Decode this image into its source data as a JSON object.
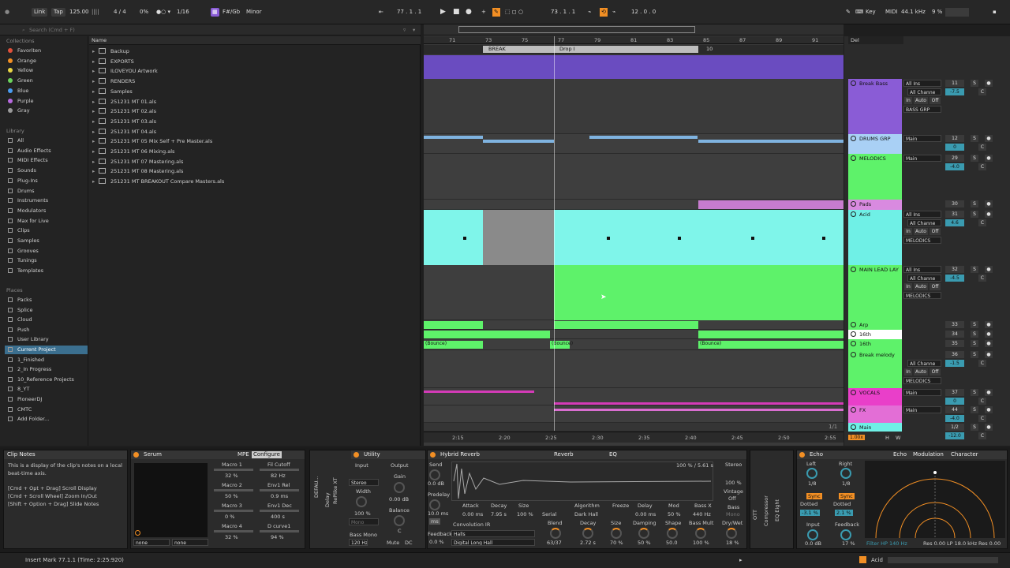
{
  "transport": {
    "link": "Link",
    "tap": "Tap",
    "tempo": "125.00",
    "meter": "4 / 4",
    "cpu_pct": "0%",
    "quant": "1/16",
    "key": "F#/Gb",
    "scale": "Minor",
    "position": "77 .  1 .  1",
    "loop_start": "73 .  1 .  1",
    "loop_len": "12 .  0 .  0",
    "key_label": "Key",
    "midi_label": "MIDI",
    "sample_rate": "44.1 kHz",
    "cpu": "9 %"
  },
  "browser": {
    "search_placeholder": "Search (Cmd + F)",
    "name_header": "Name",
    "collections_title": "Collections",
    "collections": [
      {
        "label": "Favoriten",
        "color": "#e0513b"
      },
      {
        "label": "Orange",
        "color": "#f28f24"
      },
      {
        "label": "Yellow",
        "color": "#e9d545"
      },
      {
        "label": "Green",
        "color": "#6bd35c"
      },
      {
        "label": "Blue",
        "color": "#4a9cf0"
      },
      {
        "label": "Purple",
        "color": "#b86ae0"
      },
      {
        "label": "Gray",
        "color": "#9a9a9a"
      }
    ],
    "library_title": "Library",
    "library": [
      "All",
      "Audio Effects",
      "MIDI Effects",
      "Sounds",
      "Plug-Ins",
      "Drums",
      "Instruments",
      "Modulators",
      "Max for Live",
      "Clips",
      "Samples",
      "Grooves",
      "Tunings",
      "Templates"
    ],
    "places_title": "Places",
    "places": [
      "Packs",
      "Splice",
      "Cloud",
      "Push",
      "User Library",
      "Current Project",
      "1_Finished",
      "2_In Progress",
      "10_Reference Projects",
      "8_YT",
      "PioneerDJ",
      "CMTC",
      "Add Folder..."
    ],
    "files": [
      "Backup",
      "EXPORTS",
      "ILOVEYOU Artwork",
      "RENDERS",
      "Samples",
      "251231 MT 01.als",
      "251231 MT 02.als",
      "251231 MT 03.als",
      "251231 MT 04.als",
      "251231 MT 05 Mix Self + Pre Master.als",
      "251231 MT 06 Mixing.als",
      "251231 MT 07 Mastering.als",
      "251231 MT 08 Mastering.als",
      "251231 MT BREAKOUT Compare Masters.als"
    ]
  },
  "arrangement": {
    "bars": [
      "71",
      "73",
      "75",
      "77",
      "79",
      "81",
      "83",
      "85",
      "87",
      "89",
      "91",
      "93"
    ],
    "locators": [
      "BREAK",
      "Drop I",
      "10"
    ],
    "times": [
      "2:15",
      "2:20",
      "2:25",
      "2:30",
      "2:35",
      "2:40",
      "2:45",
      "2:50",
      "2:55"
    ],
    "bounce": "(Bounce)",
    "zoom": "1/1"
  },
  "tracks": [
    {
      "name": "Break Bass",
      "color": "#8a5cd6",
      "num": "11",
      "vol": "-7.5",
      "io": "All Ins",
      "ch": "All Channe",
      "out": "BASS GRP"
    },
    {
      "name": "DRUMS GRP",
      "color": "#a9d0f5",
      "num": "12",
      "vol": "0",
      "io": "Main"
    },
    {
      "name": "MELODICS",
      "color": "#5ef26a",
      "num": "29",
      "vol": "-4.0",
      "io": "Main"
    },
    {
      "name": "Pads",
      "color": "#d98ae0",
      "num": "30"
    },
    {
      "name": "Acid",
      "color": "#6ff0e6",
      "num": "31",
      "vol": "4.6",
      "io": "All Ins",
      "ch": "All Channe",
      "out": "MELODICS"
    },
    {
      "name": "MAIN LEAD LAY",
      "color": "#5ef26a",
      "num": "32",
      "vol": "-4.5",
      "io": "All Ins",
      "ch": "All Channe",
      "out": "MELODICS"
    },
    {
      "name": "Arp",
      "color": "#5ef26a",
      "num": "33"
    },
    {
      "name": "16th",
      "color": "#ffffff",
      "num": "34"
    },
    {
      "name": "16th",
      "color": "#5ef26a",
      "num": "35"
    },
    {
      "name": "Break melody",
      "color": "#5ef26a",
      "num": "36",
      "vol": "-1.5",
      "ch": "All Channe",
      "out": "MELODICS"
    },
    {
      "name": "VOCALS",
      "color": "#e93fc9",
      "num": "37",
      "vol": "0",
      "io": "Main"
    },
    {
      "name": "FX",
      "color": "#e36ed6",
      "num": "44",
      "vol": "-4.0",
      "io": "Main"
    },
    {
      "name": "Main",
      "color": "#6ff0e6",
      "num": "1/2",
      "vol": "-12.0"
    }
  ],
  "mixer": {
    "auto": "Auto",
    "in": "In",
    "off": "Off",
    "s": "S",
    "c": "C",
    "dei": "Del",
    "main_zoom": "1.00x",
    "h": "H",
    "w": "W"
  },
  "clip_notes": {
    "title": "Clip Notes",
    "text1": "This is a display of the clip's notes on a local beat-time axis.",
    "text2": "[Cmd + Opt + Drag] Scroll Display",
    "text3": "[Cmd + Scroll Wheel] Zoom In/Out",
    "text4": "[Shift + Option + Drag] Slide Notes"
  },
  "serum": {
    "title": "Serum",
    "mpe": "MPE",
    "configure": "Configure",
    "macros": [
      {
        "name": "Macro 1",
        "val": "32 %"
      },
      {
        "name": "Fil Cutoff",
        "val": "82 Hz"
      },
      {
        "name": "Macro 2",
        "val": "50 %"
      },
      {
        "name": "Env1 Rel",
        "val": "0.9 ms"
      },
      {
        "name": "Macro 3",
        "val": "0 %"
      },
      {
        "name": "Env1 Dec",
        "val": "400 s"
      },
      {
        "name": "Macro 4",
        "val": "32 %"
      },
      {
        "name": "D curve1",
        "val": "94 %"
      }
    ],
    "none1": "none",
    "none2": "none"
  },
  "utility": {
    "title": "Utility",
    "input": "Input",
    "output": "Output",
    "gain": "Gain",
    "gain_val": "0.00 dB",
    "width": "Width",
    "width_val": "100 %",
    "stereo": "Stereo",
    "mono": "Mono",
    "balance": "Balance",
    "bal_val": "C",
    "bass_mono": "Bass Mono",
    "freq": "120 Hz",
    "mute": "Mute",
    "dc": "DC",
    "vertical": [
      "DEFAU...",
      "RePlike XT",
      "Delay"
    ]
  },
  "reverb": {
    "title": "Hybrid Reverb",
    "tab1": "Reverb",
    "tab2": "EQ",
    "send": "Send",
    "send_val": "0.0 dB",
    "predelay": "Predelay",
    "predelay_val": "10.0 ms",
    "ms": "ms",
    "feedback": "Feedback",
    "feedback_val": "0.0 %",
    "readout": "100 % / 5.61 s",
    "attack": "Attack",
    "decay": "Decay",
    "size": "Size",
    "algorithm": "Algorithm",
    "freeze": "Freeze",
    "delay": "Delay",
    "mod": "Mod",
    "bassx": "Bass X",
    "attack_val": "0.00 ms",
    "decay_val": "7.95 s",
    "size_val": "100 %",
    "serial": "Serial",
    "dark_hall": "Dark Hall",
    "delay_val": "0.00 ms",
    "mod_val": "50 %",
    "bassx_val": "440 Hz",
    "conv": "Convolution IR",
    "halls": "Halls",
    "digital": "Digital Long Hall",
    "blend": "Blend",
    "blend_val": "63/37",
    "decay2": "Decay",
    "decay2_val": "2.72 s",
    "size2": "Size",
    "size2_val": "70 %",
    "damping": "Damping",
    "damp_val": "50 %",
    "shape": "Shape",
    "shape_val": "50.0",
    "bassmult": "Bass Mult",
    "bassmult_val": "100 %",
    "stereo": "Stereo",
    "stereo_val": "100 %",
    "vintage": "Vintage",
    "vintage_val": "Off",
    "bass": "Bass",
    "bass_val": "Mono",
    "drywet": "Dry/Wet",
    "drywet_val": "18 %"
  },
  "side_vert": [
    "OTT",
    "Compressor",
    "EQ Eight"
  ],
  "echo": {
    "title": "Echo",
    "tab1": "Echo",
    "tab2": "Modulation",
    "tab3": "Character",
    "left": "Left",
    "right": "Right",
    "l_div": "1/8",
    "r_div": "1/8",
    "sync": "Sync",
    "dotted": "Dotted",
    "l_pct": "-3.1 %",
    "r_pct": "2.1 %",
    "input": "Input",
    "input_val": "0.0 dB",
    "feedback": "Feedback",
    "feedback_val": "17 %",
    "filter": "Filter HP 140 Hz",
    "res1": "Res 0.00",
    "lp": "LP 18.0 kHz",
    "res2": "Res 0.00"
  },
  "status": {
    "text": "Insert Mark 77.1.1 (Time: 2:25:920)",
    "track": "Acid"
  }
}
